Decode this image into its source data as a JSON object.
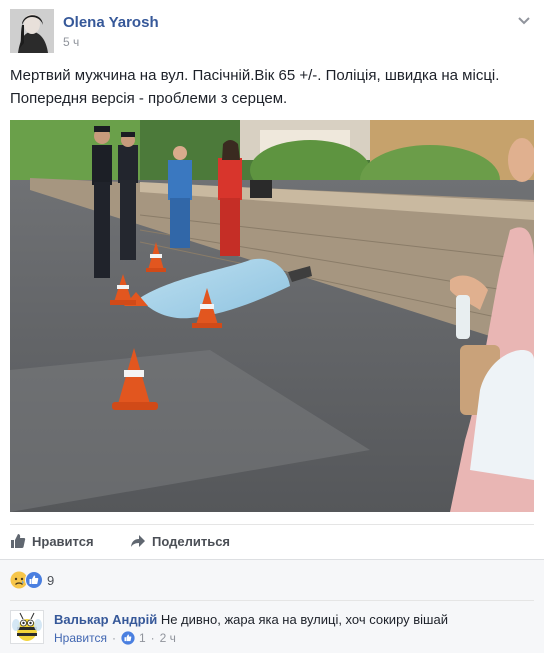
{
  "post": {
    "author": "Olena Yarosh",
    "time": "5 ч",
    "text_line1": "Мертвий мужчина на вул. Пасічній.Вік 65 +/-. Поліція, швидка на місці.",
    "text_line2": "Попередня версія - проблеми з серцем."
  },
  "actions": {
    "like_label": "Нравится",
    "share_label": "Поделиться"
  },
  "reactions": {
    "icons": [
      "sad-reaction-icon",
      "like-reaction-icon"
    ],
    "count": "9"
  },
  "comment": {
    "author": "Валькар Андрій",
    "text": "Не дивно, жара яка на вулиці, хоч сокиру вішай",
    "like_label": "Нравится",
    "like_count": "1",
    "time": "2 ч"
  },
  "colors": {
    "link": "#365899",
    "accent": "#4267b2",
    "muted": "#90949c"
  }
}
